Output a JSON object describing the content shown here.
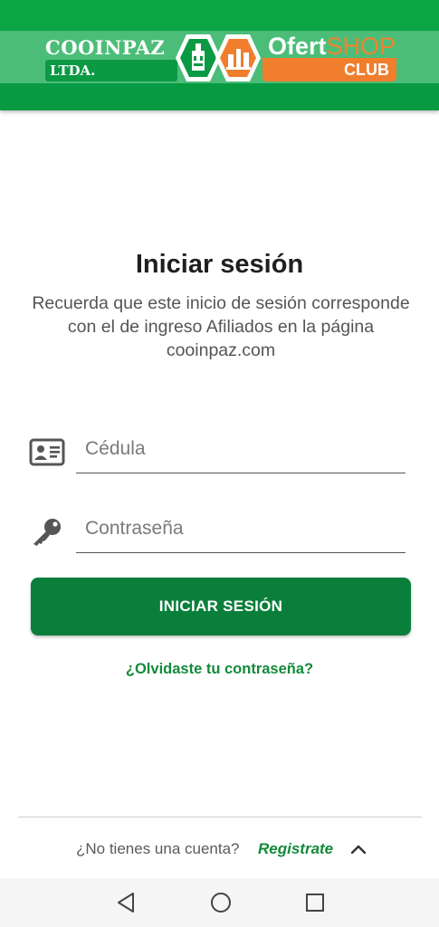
{
  "header": {
    "brand_name": "COOINPAZ",
    "brand_suffix": "LTDA.",
    "shop_word_1": "Ofert",
    "shop_word_2": "SHOP",
    "shop_club": "CLUB"
  },
  "main": {
    "title": "Iniciar sesión",
    "subtitle": "Recuerda que este inicio de sesión corresponde con el de ingreso Afiliados en la página cooinpaz.com",
    "cedula_placeholder": "Cédula",
    "cedula_value": "",
    "password_placeholder": "Contraseña",
    "password_value": "",
    "login_label": "INICIAR SESIÓN",
    "forgot_label": "¿Olvidaste tu contraseña?"
  },
  "footer": {
    "question": "¿No tienes una cuenta?",
    "register_label": "Registrate"
  },
  "navbar": {
    "buttons": [
      "back-triangle",
      "home-circle",
      "recents-square"
    ]
  },
  "colors": {
    "header_green": "#0aa646",
    "accent_green": "#0a7f3b",
    "link_green": "#138a3a",
    "orange": "#f07e2c"
  }
}
